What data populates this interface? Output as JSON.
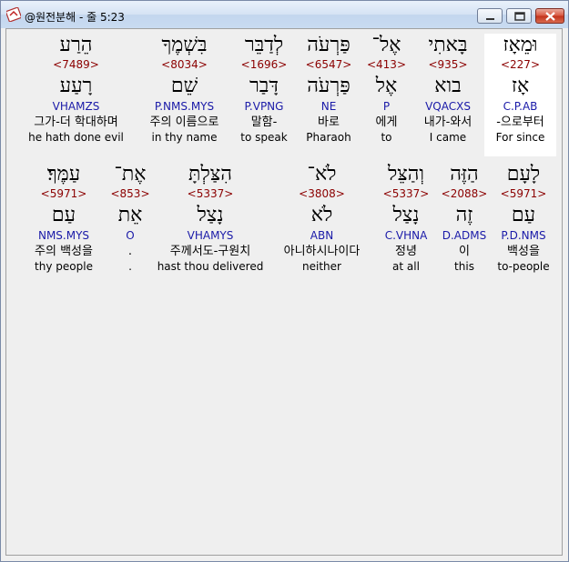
{
  "window": {
    "title": "@원전분해 - 줄 5:23",
    "icon": "hebrew-app-icon"
  },
  "rows": [
    [
      {
        "heb": "וּמֵאָז",
        "num": "<227>",
        "lemma": "אָז",
        "parse": "C.P.AB",
        "kor": "-으로부터",
        "eng": "For since",
        "highlight": true
      },
      {
        "heb": "בָּאתִי",
        "num": "<935>",
        "lemma": "בוא",
        "parse": "VQACXS",
        "kor": "내가-와서",
        "eng": "I came",
        "highlight": false
      },
      {
        "heb": "אֶל־",
        "num": "<413>",
        "lemma": "אֶל",
        "parse": "P",
        "kor": "에게",
        "eng": "to",
        "highlight": false
      },
      {
        "heb": "פַּרְעֹה",
        "num": "<6547>",
        "lemma": "פַּרְעֹה",
        "parse": "NE",
        "kor": "바로",
        "eng": "Pharaoh",
        "highlight": false
      },
      {
        "heb": "לְדַבֵּר",
        "num": "<1696>",
        "lemma": "דָּבַר",
        "parse": "P.VPNG",
        "kor": "말함-",
        "eng": "to speak",
        "highlight": false
      },
      {
        "heb": "בִּשְׁמֶךָ",
        "num": "<8034>",
        "lemma": "שֵׁם",
        "parse": "P.NMS.MYS",
        "kor": "주의 이름으로",
        "eng": "in thy name",
        "highlight": false
      },
      {
        "heb": "הֵרַע",
        "num": "<7489>",
        "lemma": "רָעַע",
        "parse": "VHAMZS",
        "kor": "그가-더 학대하며",
        "eng": "he hath done evil",
        "highlight": false
      }
    ],
    [
      {
        "heb": "לָעָם",
        "num": "<5971>",
        "lemma": "עַם",
        "parse": "P.D.NMS",
        "kor": "백성을",
        "eng": "to-people",
        "highlight": false
      },
      {
        "heb": "הַזֶּה",
        "num": "<2088>",
        "lemma": "זֶה",
        "parse": "D.ADMS",
        "kor": "이",
        "eng": "this",
        "highlight": false
      },
      {
        "heb": "וְהַצֵּל",
        "num": "<5337>",
        "lemma": "נָצַל",
        "parse": "C.VHNA",
        "kor": "정녕",
        "eng": "at all",
        "highlight": false
      },
      {
        "heb": "לֹא־",
        "num": "<3808>",
        "lemma": "לֹא",
        "parse": "ABN",
        "kor": "아니하시나이다",
        "eng": "neither",
        "highlight": false
      },
      {
        "heb": "הִצַּלְתָּ",
        "num": "<5337>",
        "lemma": "נָצַל",
        "parse": "VHAMYS",
        "kor": "주께서도-구원치",
        "eng": "hast thou delivered",
        "highlight": false
      },
      {
        "heb": "אֶת־",
        "num": "<853>",
        "lemma": "אֵת",
        "parse": "O",
        "kor": ".",
        "eng": ".",
        "highlight": false
      },
      {
        "heb": "עַמֶּךָ׃",
        "num": "<5971>",
        "lemma": "עַם",
        "parse": "NMS.MYS",
        "kor": "주의 백성을",
        "eng": "thy people",
        "highlight": false
      }
    ]
  ]
}
